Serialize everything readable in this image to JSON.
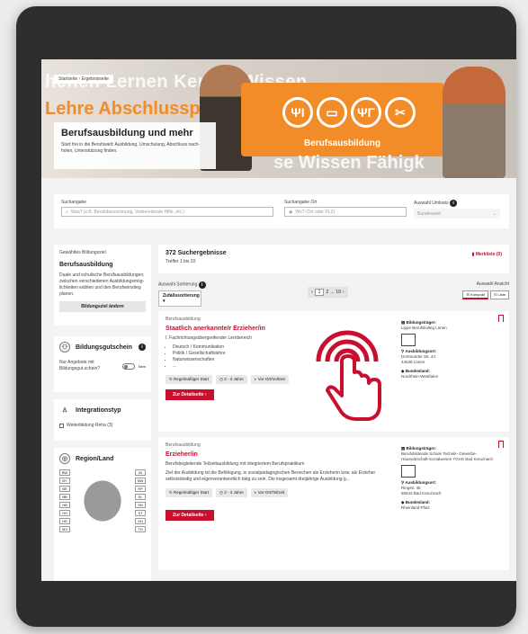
{
  "hero": {
    "breadcrumb": "Startseite › Ergebnisseite",
    "bgwords1": "hchen  Lernen  Kenn  e  Wissen",
    "bgwords2": "Lehre  Abschlussprüfu",
    "bgwords3": "se  Wissen  Fähigk",
    "band_label": "Berufsausbildung",
    "title": "Berufsausbildung und mehr",
    "subtitle": "Start frei in die Berufswelt: Ausbildung, Umschulung, Abschluss nach-holen, Unterstützung finden."
  },
  "search": {
    "what_label": "Suchangabe",
    "what_placeholder": "Was? (z.B. Berufsbezeichnung, Vorbereitende Hilfe, etc.)",
    "where_label": "Suchangabe Ort",
    "where_placeholder": "Wo? (Ort oder PLZ)",
    "radius_label": "Auswahl Umkreis",
    "radius_value": "Bundesweit"
  },
  "sidebar": {
    "goal_label": "Gewähltes Bildungsziel",
    "goal_title": "Berufsausbildung",
    "goal_desc": "Duale und schulische Berufsausbildungen; zwischen verschiedenen Ausbildungsmög-lichkeiten wählen und den Berufseinstieg planen.",
    "goal_button": "Bildungsziel ändern",
    "voucher_title": "Bildungsgutschein",
    "voucher_text": "Nur Angebote mit Bildungsgut-schein?",
    "voucher_toggle": "Nein",
    "integration_title": "Integrationstyp",
    "integration_option": "Weiterbildung Reha (3)",
    "region_title": "Region/Land",
    "states_left": [
      "BW",
      "BY",
      "BE",
      "BB",
      "HB",
      "HH",
      "HE",
      "MV"
    ],
    "states_right": [
      "NI",
      "NW",
      "RP",
      "SL",
      "SN",
      "ST",
      "SH",
      "TH"
    ]
  },
  "results": {
    "count": "372 Suchergebnisse",
    "range": "Treffer 1 bis 20",
    "merkliste": "Merkliste (0)",
    "sort_label": "Auswahl Sortierung",
    "sort_value": "Zufallssortierung",
    "pages": [
      "1",
      "2",
      "...",
      "19"
    ],
    "view_label": "Auswahl Ansicht",
    "view_compact": "Kompakt",
    "view_list": "Liste"
  },
  "cards": [
    {
      "category": "Berufsausbildung",
      "title": "Staatlich anerkannte/r Erzieher/in",
      "subtitle": "I. Fachrichtungsübergreifender Lernbereich",
      "bullets": [
        "Deutsch / Kommunikation",
        "Politik / Gesellschaftslehre",
        "Naturwissenschaften",
        "..."
      ],
      "chips": [
        "Regelmäßiger Start",
        "2 - 3 Jahre",
        "Vor-Ort/Vollzeit"
      ],
      "button": "Zur Detailseite  ›",
      "provider_label": "Bildungsträger:",
      "provider": "Lippe Berufskolleg Lünen",
      "location_label": "Ausbildungsort:",
      "location": [
        "Dortmunder Str. 44",
        "44536 Lünen"
      ],
      "state_label": "Bundesland:",
      "state": "Nordrhein-Westfalen"
    },
    {
      "category": "Berufsausbildung",
      "title": "Erzieher/in",
      "subtitle": "Berufsbegleitende Teilzeitausbildung mit integriertem Berufspraktikum",
      "desc": "Ziel der Ausbildung ist die Befähigung, in sozialpädagogischen Bereichen als Erzieherin bzw. als Erzieher selbstständig und eigenverantwortlich tätig zu sein. Die insgesamt dreijährige Ausbildung g...",
      "chips": [
        "Regelmäßiger Start",
        "2 - 3 Jahre",
        "Vor-Ort/Teilzeit"
      ],
      "button": "Zur Detailseite  ›",
      "provider_label": "Bildungsträger:",
      "provider": "Berufsbildende Schule Technik- Gewerbe-Hauswirtschaft-Sozialwesen TGHS Bad Kreuznach",
      "location_label": "Ausbildungsort:",
      "location": [
        "Ringstr. 45",
        "55543 Bad Kreuznach"
      ],
      "state_label": "Bundesland:",
      "state": "Rheinland-Pfalz"
    }
  ],
  "colors": {
    "accent": "#c8102e",
    "orange": "#f28c28",
    "device": "#2e2e2e"
  }
}
